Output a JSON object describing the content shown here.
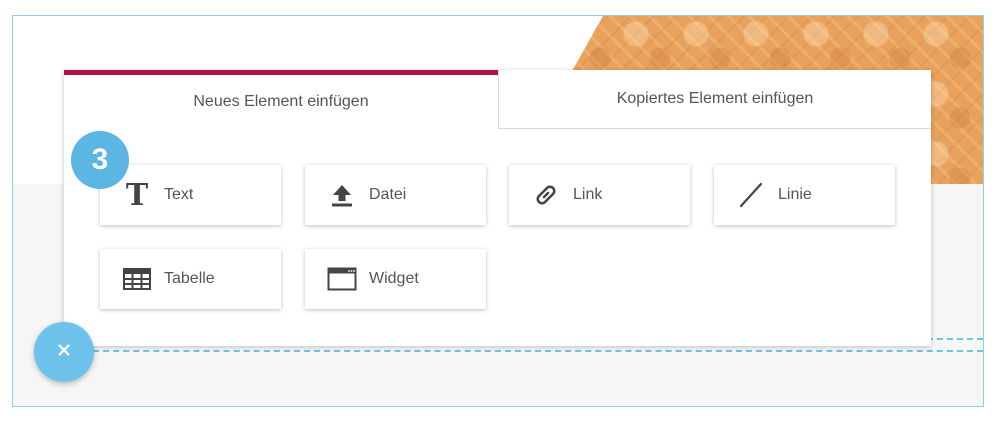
{
  "tabs": {
    "new_element": "Neues Element einfügen",
    "copied_element": "Kopiertes Element einfügen"
  },
  "step_badge": "3",
  "elements": [
    {
      "label": "Text",
      "icon": "text-icon"
    },
    {
      "label": "Datei",
      "icon": "upload-icon"
    },
    {
      "label": "Link",
      "icon": "link-icon"
    },
    {
      "label": "Linie",
      "icon": "line-icon"
    },
    {
      "label": "Tabelle",
      "icon": "table-icon"
    },
    {
      "label": "Widget",
      "icon": "widget-icon"
    }
  ],
  "colors": {
    "active_tab_accent": "#b5104d",
    "badge": "#5bb6e3",
    "close_button": "#6ec1ea",
    "frame_border": "#8fd0ea"
  }
}
